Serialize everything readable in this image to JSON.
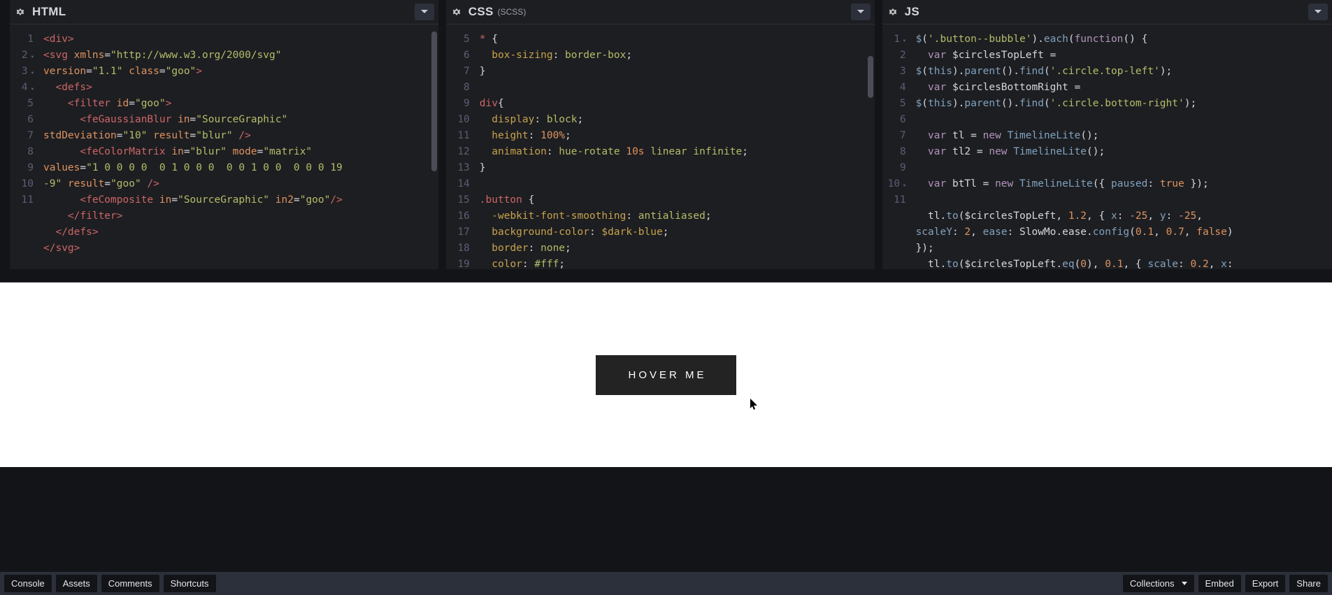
{
  "panes": {
    "html": {
      "title": "HTML",
      "subtitle": ""
    },
    "css": {
      "title": "CSS",
      "subtitle": "(SCSS)"
    },
    "js": {
      "title": "JS",
      "subtitle": ""
    }
  },
  "html_gutter": [
    "1",
    "2",
    "3",
    "4",
    "5",
    "6",
    "7",
    "8",
    "9",
    "10",
    "11"
  ],
  "html_fold_rows": [
    2,
    3,
    4
  ],
  "css_gutter": [
    "5",
    "6",
    "7",
    "8",
    "9",
    "10",
    "11",
    "12",
    "13",
    "14",
    "15",
    "16",
    "17",
    "18",
    "19"
  ],
  "js_gutter": [
    "1",
    "2",
    "3",
    "4",
    "5",
    "6",
    "7",
    "8",
    "9",
    "10",
    "11"
  ],
  "js_fold_rows": [
    1,
    10
  ],
  "html_code": [
    "<div>",
    "<svg xmlns=\"http://www.w3.org/2000/svg\" version=\"1.1\" class=\"goo\">",
    "  <defs>",
    "    <filter id=\"goo\">",
    "      <feGaussianBlur in=\"SourceGraphic\" stdDeviation=\"10\" result=\"blur\" />",
    "      <feColorMatrix in=\"blur\" mode=\"matrix\" values=\"1 0 0 0 0  0 1 0 0 0  0 0 1 0 0  0 0 0 19 -9\" result=\"goo\" />",
    "      <feComposite in=\"SourceGraphic\" in2=\"goo\"/>",
    "    </filter>",
    "  </defs>",
    "</svg>"
  ],
  "css_code": [
    "* {",
    "  box-sizing: border-box;",
    "}",
    "",
    "div{",
    "  display: block;",
    "  height: 100%;",
    "  animation: hue-rotate 10s linear infinite;",
    "}",
    "",
    ".button {",
    "  -webkit-font-smoothing: antialiased;",
    "  background-color: $dark-blue;",
    "  border: none;",
    "  color: #fff;"
  ],
  "js_code": [
    "$('.button--bubble').each(function() {",
    "  var $circlesTopLeft = $(this).parent().find('.circle.top-left');",
    "  var $circlesBottomRight = $(this).parent().find('.circle.bottom-right');",
    "",
    "  var tl = new TimelineLite();",
    "  var tl2 = new TimelineLite();",
    "",
    "  var btTl = new TimelineLite({ paused: true });",
    "",
    "  tl.to($circlesTopLeft, 1.2, { x: -25, y: -25, scaleY: 2, ease: SlowMo.ease.config(0.1, 0.7, false) });",
    "  tl.to($circlesTopLeft.eq(0), 0.1, { scale: 0.2, x:"
  ],
  "preview": {
    "button_label": "HOVER ME"
  },
  "footer": {
    "left": [
      "Console",
      "Assets",
      "Comments",
      "Shortcuts"
    ],
    "right": [
      "Collections",
      "Embed",
      "Export",
      "Share"
    ]
  }
}
